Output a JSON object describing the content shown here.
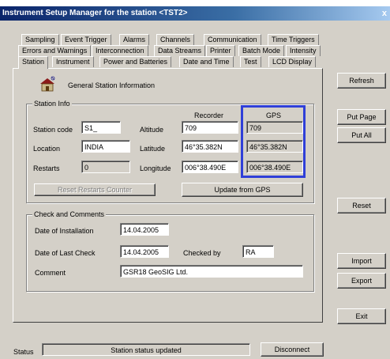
{
  "window": {
    "title": "Instrument Setup Manager for the station <TST2>",
    "close_glyph": "x"
  },
  "tabs": {
    "row1": [
      "Sampling",
      "Event Trigger",
      "Alarms",
      "Channels",
      "Communication",
      "Time Triggers"
    ],
    "row2": [
      "Errors and Warnings",
      "Interconnection",
      "Data Streams",
      "Printer",
      "Batch Mode",
      "Intensity"
    ],
    "row3": [
      "Station",
      "Instrument",
      "Power and Batteries",
      "Date and Time",
      "Test",
      "LCD Display"
    ],
    "active": "Station"
  },
  "header": {
    "icon": "station-house-icon",
    "title": "General Station Information"
  },
  "station_info": {
    "group_title": "Station Info",
    "col_recorder": "Recorder",
    "col_gps": "GPS",
    "station_code_label": "Station code",
    "station_code": "S1_",
    "location_label": "Location",
    "location": "INDIA",
    "restarts_label": "Restarts",
    "restarts": "0",
    "altitude_label": "Altitude",
    "altitude_recorder": "709",
    "altitude_gps": "709",
    "latitude_label": "Latitude",
    "latitude_recorder": "46°35.382N",
    "latitude_gps": "46°35.382N",
    "longitude_label": "Longitude",
    "longitude_recorder": "006°38.490E",
    "longitude_gps": "006°38.490E",
    "reset_restarts_label": "Reset Restarts Counter",
    "update_gps_label": "Update from GPS"
  },
  "check": {
    "group_title": "Check and Comments",
    "installation_label": "Date of Installation",
    "installation_date": "14.04.2005",
    "last_check_label": "Date of Last Check",
    "last_check_date": "14.04.2005",
    "checked_by_label": "Checked by",
    "checked_by": "RA",
    "comment_label": "Comment",
    "comment": "GSR18 GeoSIG Ltd."
  },
  "side_buttons": {
    "refresh": "Refresh",
    "put_page": "Put Page",
    "put_all": "Put All",
    "reset": "Reset",
    "import": "Import",
    "export": "Export",
    "exit": "Exit"
  },
  "status_bar": {
    "label": "Status",
    "text": "Station status updated",
    "disconnect": "Disconnect"
  },
  "colors": {
    "highlight_box": "#2f3fd8",
    "title_bar": "#0a246a"
  }
}
